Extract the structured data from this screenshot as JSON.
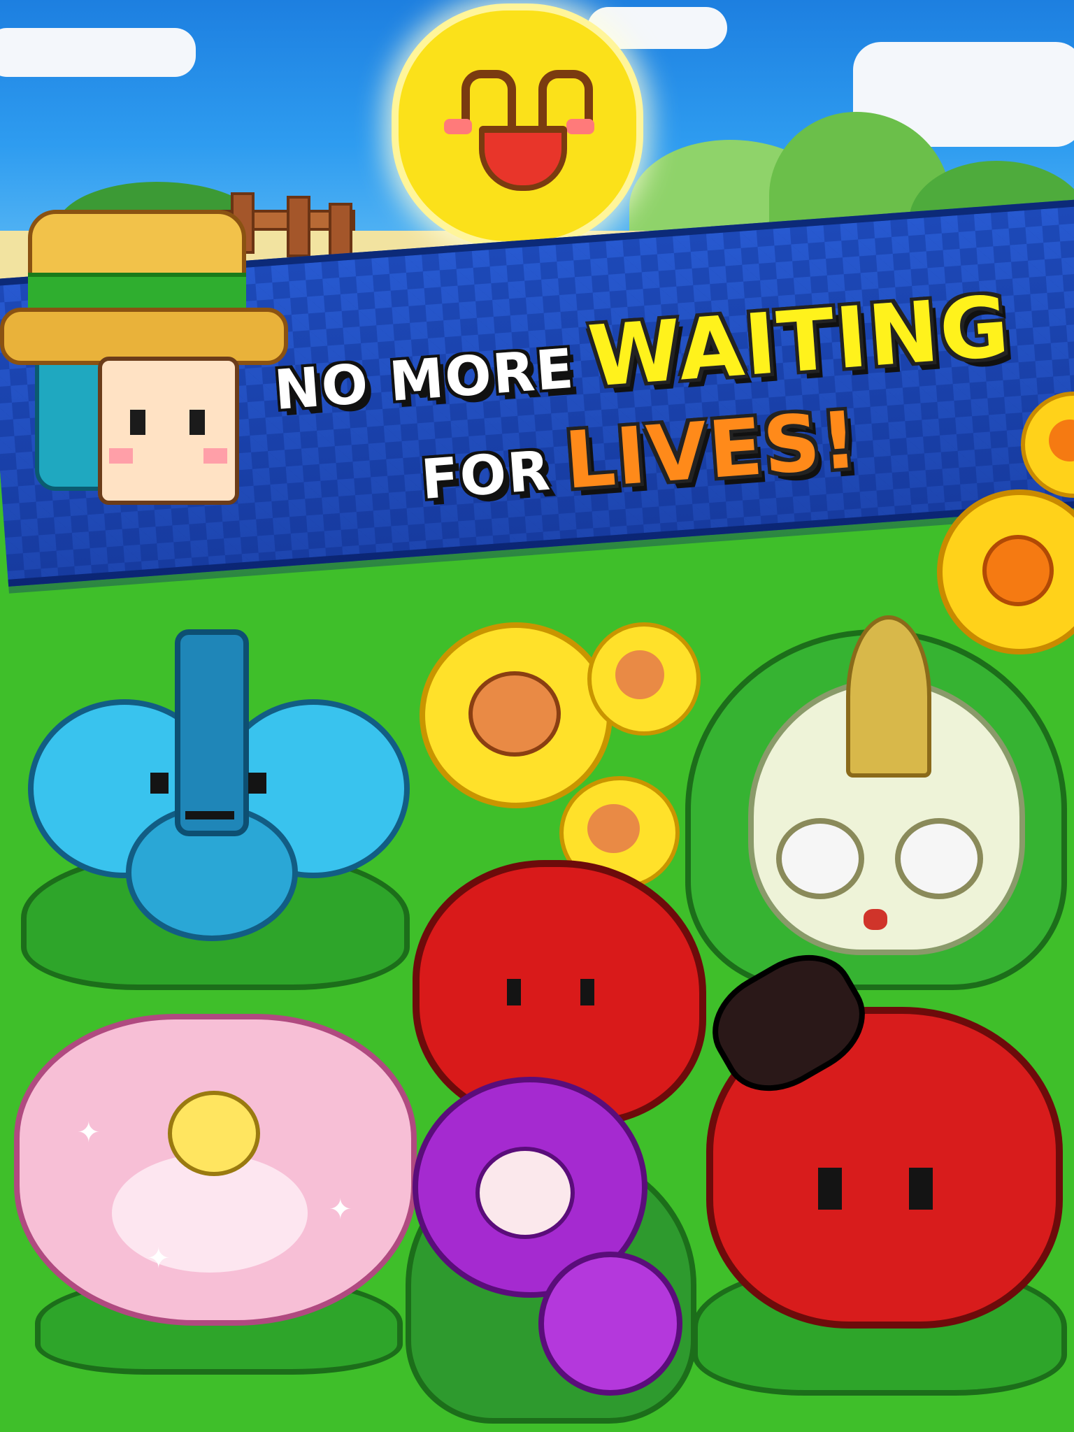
{
  "headline": {
    "line1_white": "NO MORE",
    "line1_highlight": "WAITING",
    "line2_white": "FOR",
    "line2_highlight": "LIVES!"
  },
  "colors": {
    "banner_blue": "#1d49b8",
    "highlight_yellow": "#fff21c",
    "highlight_orange": "#ff8a1a",
    "grass_green": "#3fbf2a",
    "sun_yellow": "#fbe11a"
  },
  "characters": [
    "sun-character",
    "farmer-character",
    "blue-flower-character",
    "sunflower-cluster-character",
    "white-bulb-character",
    "red-rose-character",
    "pink-lotus-character",
    "purple-flower-character",
    "red-rose-hat-character",
    "sunflower-decoration"
  ]
}
